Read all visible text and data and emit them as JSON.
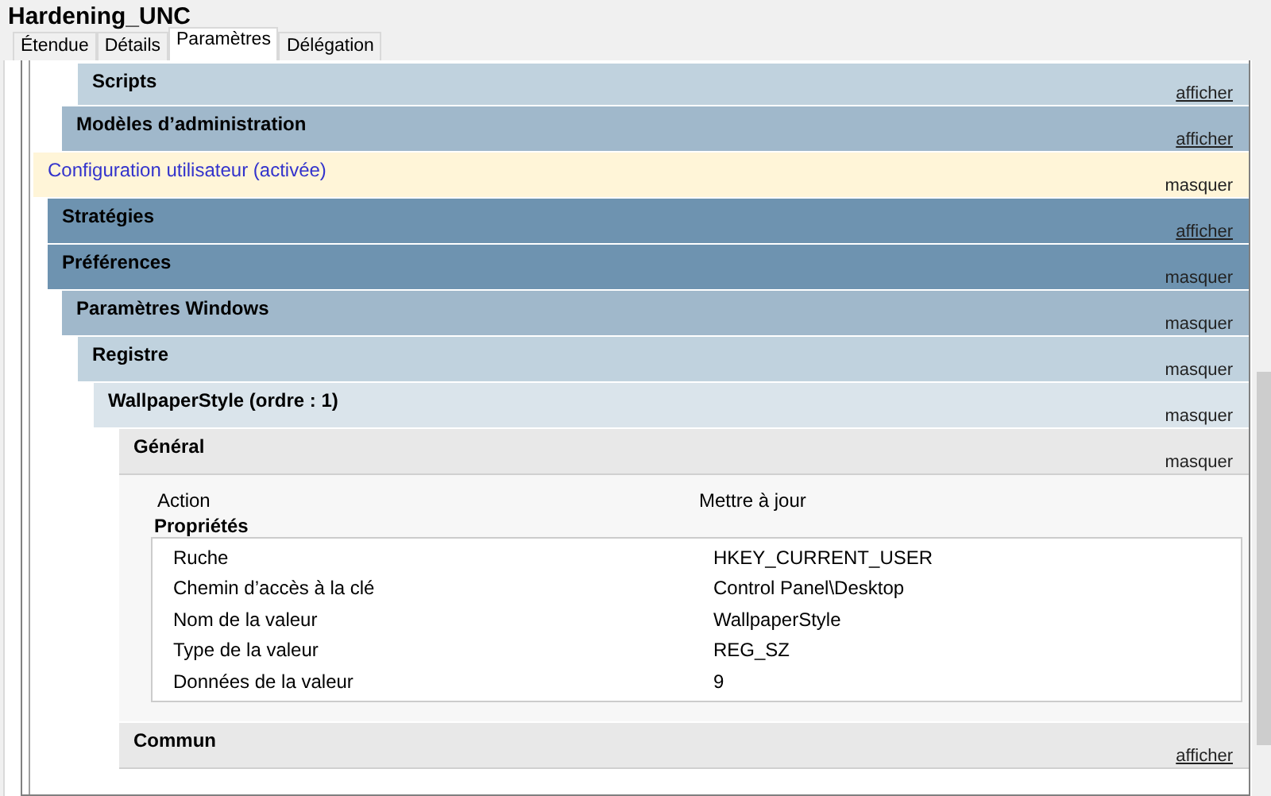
{
  "window": {
    "title": "Hardening_UNC"
  },
  "tabs": [
    {
      "label": "Étendue",
      "selected": false
    },
    {
      "label": "Détails",
      "selected": false
    },
    {
      "label": "Paramètres",
      "selected": true
    },
    {
      "label": "Délégation",
      "selected": false
    }
  ],
  "report": [
    {
      "title": "Scripts",
      "kind": "subgroup",
      "expanded": false,
      "toggle": "afficher"
    },
    {
      "title": "Modèles d’administration",
      "kind": "group",
      "expanded": false,
      "toggle": "afficher"
    },
    {
      "title": "Configuration utilisateur (activée)",
      "kind": "config",
      "expanded": true,
      "toggle": "masquer",
      "children": [
        {
          "title": "Stratégies",
          "kind": "section",
          "expanded": false,
          "toggle": "afficher"
        },
        {
          "title": "Préférences",
          "kind": "section",
          "expanded": true,
          "toggle": "masquer",
          "children": [
            {
              "title": "Paramètres Windows",
              "kind": "group",
              "expanded": true,
              "toggle": "masquer",
              "children": [
                {
                  "title": "Registre",
                  "kind": "subgroup",
                  "expanded": true,
                  "toggle": "masquer",
                  "children": [
                    {
                      "title": "WallpaperStyle (ordre : 1)",
                      "kind": "item",
                      "expanded": true,
                      "toggle": "masquer",
                      "children": [
                        {
                          "title": "Général",
                          "kind": "detail",
                          "expanded": true,
                          "toggle": "masquer",
                          "details": {
                            "action": {
                              "label": "Action",
                              "value": "Mettre à jour"
                            },
                            "properties_title": "Propriétés",
                            "properties": [
                              {
                                "label": "Ruche",
                                "value": "HKEY_CURRENT_USER"
                              },
                              {
                                "label": "Chemin d’accès à la clé",
                                "value": "Control Panel\\Desktop"
                              },
                              {
                                "label": "Nom de la valeur",
                                "value": "WallpaperStyle"
                              },
                              {
                                "label": "Type de la valeur",
                                "value": "REG_SZ"
                              },
                              {
                                "label": "Données de la valeur",
                                "value": "9"
                              }
                            ]
                          }
                        },
                        {
                          "title": "Commun",
                          "kind": "detail",
                          "expanded": false,
                          "toggle": "afficher"
                        }
                      ]
                    }
                  ]
                }
              ]
            }
          ]
        }
      ]
    }
  ]
}
